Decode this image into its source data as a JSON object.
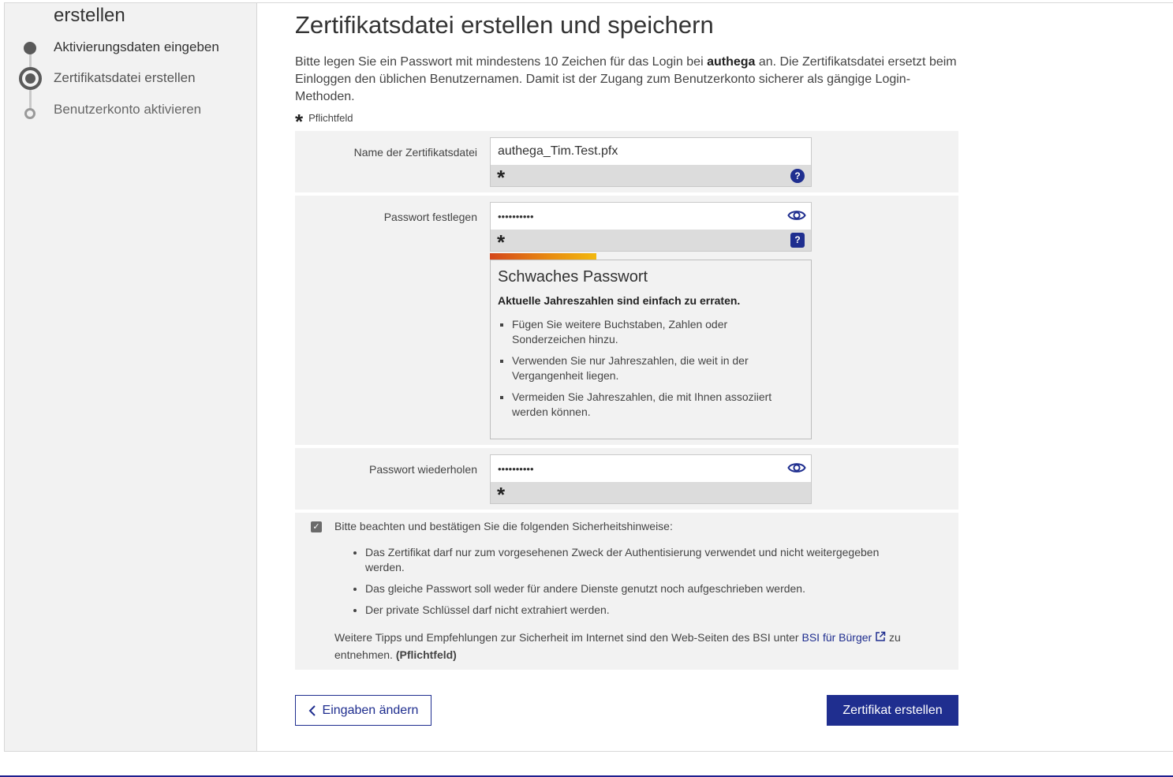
{
  "sidebar": {
    "title": "erstellen",
    "steps": [
      {
        "label": "Aktivierungsdaten eingeben",
        "state": "done"
      },
      {
        "label": "Zertifikatsdatei erstellen",
        "state": "current"
      },
      {
        "label": "Benutzerkonto aktivieren",
        "state": "todo"
      }
    ]
  },
  "main": {
    "title": "Zertifikatsdatei erstellen und speichern",
    "intro_part1": "Bitte legen Sie ein Passwort mit mindestens 10 Zeichen für das Login bei ",
    "intro_bold": "authega",
    "intro_part2": " an. Die Zertifikatsdatei ersetzt beim Einloggen den üblichen Benutzernamen. Damit ist der Zugang zum Benutzerkonto sicherer als gängige Login-Methoden.",
    "required_note": "Pflichtfeld",
    "asterisk": "*"
  },
  "form": {
    "filename": {
      "label": "Name der Zertifikatsdatei",
      "value": "authega_Tim.Test.pfx",
      "help": "?"
    },
    "password": {
      "label": "Passwort festlegen",
      "value": "••••••••••",
      "help": "?"
    },
    "password_repeat": {
      "label": "Passwort wiederholen",
      "value": "••••••••••"
    }
  },
  "strength": {
    "level": 0.33,
    "title": "Schwaches Passwort",
    "subtitle": "Aktuelle Jahreszahlen sind einfach zu erraten.",
    "tips": [
      "Fügen Sie weitere Buchstaben, Zahlen oder Sonderzeichen hinzu.",
      "Verwenden Sie nur Jahreszahlen, die weit in der Vergangenheit liegen.",
      "Vermeiden Sie Jahreszahlen, die mit Ihnen assoziiert werden können."
    ]
  },
  "consent": {
    "checked": true,
    "checkmark": "✓",
    "intro": "Bitte beachten und bestätigen Sie die folgenden Sicherheitshinweise:",
    "items": [
      "Das Zertifikat darf nur zum vorgesehenen Zweck der Authentisierung verwendet und nicht weitergegeben werden.",
      "Das gleiche Passwort soll weder für andere Dienste genutzt noch aufgeschrieben werden.",
      "Der private Schlüssel darf nicht extrahiert werden."
    ],
    "footer_part1": "Weitere Tipps und Empfehlungen zur Sicherheit im Internet sind den Web-Seiten des BSI unter ",
    "link_label": "BSI für Bürger",
    "footer_part2": " zu entnehmen. ",
    "footer_bold": "(Pflichtfeld)"
  },
  "buttons": {
    "back": "Eingaben ändern",
    "submit": "Zertifikat erstellen"
  },
  "colors": {
    "primary": "#1f2e8f",
    "panel_bg": "#f2f2f2",
    "strength_start": "#d4461a",
    "strength_end": "#f2b80e"
  }
}
